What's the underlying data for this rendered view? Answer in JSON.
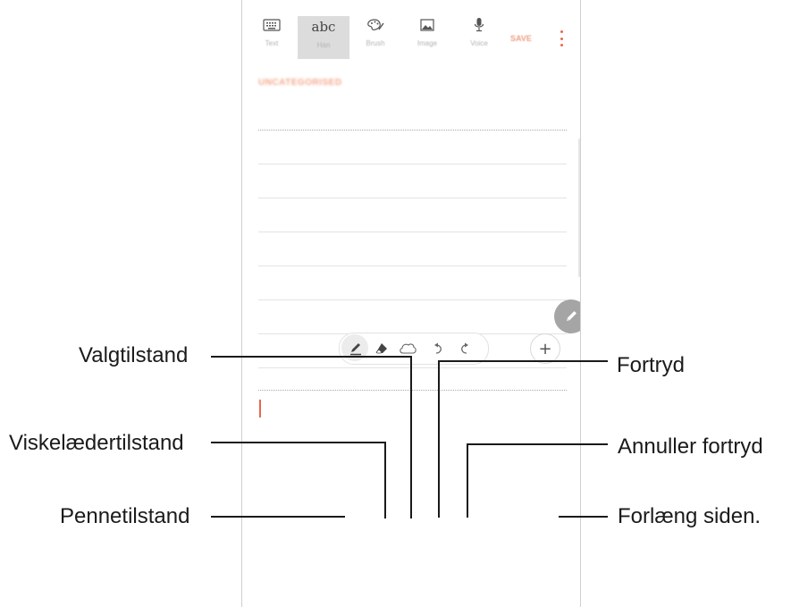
{
  "toolbar": {
    "tools": [
      {
        "label": "Text",
        "icon": "keyboard-icon"
      },
      {
        "label": "Han",
        "icon": "abc-handwriting-icon",
        "icon_text": "abc"
      },
      {
        "label": "Brush",
        "icon": "palette-icon"
      },
      {
        "label": "Image",
        "icon": "image-icon"
      },
      {
        "label": "Voice",
        "icon": "microphone-icon"
      }
    ],
    "save_label": "SAVE",
    "more_icon": "more-vertical-icon"
  },
  "note": {
    "category": "UNCATEGORISED"
  },
  "pen_toolbar": {
    "tools": [
      "pen-icon",
      "eraser-icon",
      "lasso-select-icon",
      "undo-icon",
      "redo-icon"
    ],
    "selected": "pen-icon",
    "add_icon": "plus-icon",
    "add_symbol": "+"
  },
  "callouts": {
    "selection_mode": "Valgtilstand",
    "eraser_mode": "Viskelædertilstand",
    "pen_mode": "Pennetilstand",
    "undo": "Fortryd",
    "redo": "Annuller fortryd",
    "extend_page": "Forlæng siden."
  },
  "colors": {
    "accent": "#e8674a",
    "leader_line": "#1a1a1a",
    "toolbar_selected_bg": "#dcdcdc"
  }
}
